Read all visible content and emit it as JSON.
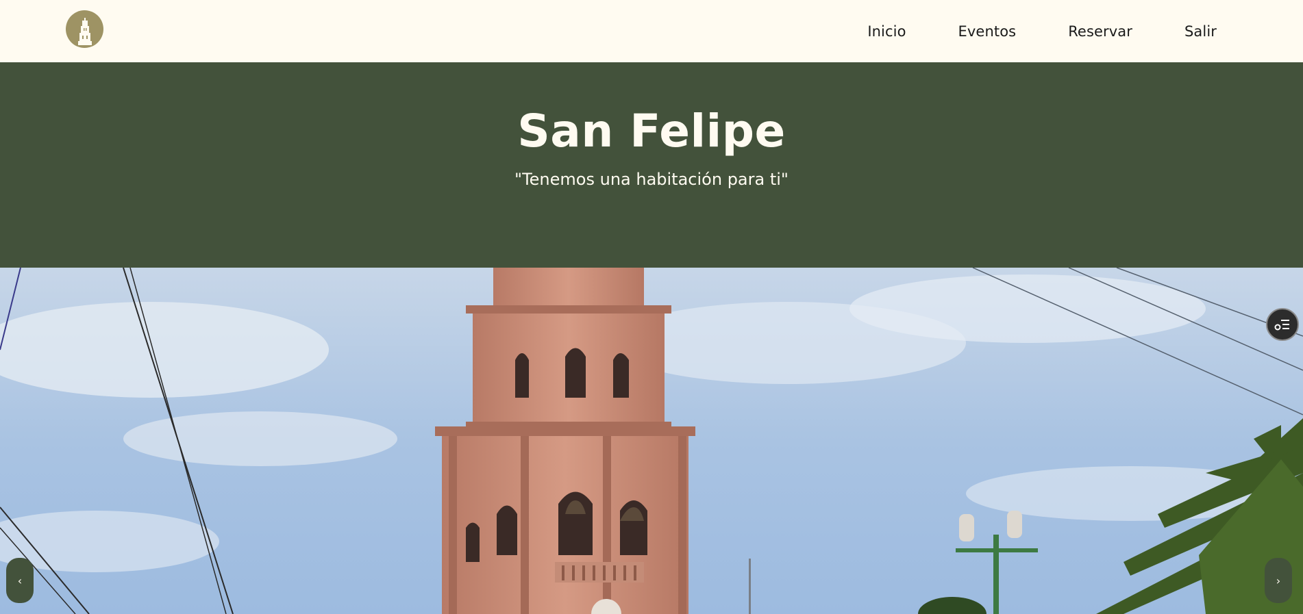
{
  "nav": {
    "logo_alt": "San Felipe logo",
    "links": [
      "Inicio",
      "Eventos",
      "Reservar",
      "Salir"
    ]
  },
  "hero": {
    "title": "San Felipe",
    "subtitle": "\"Tenemos una habitación para ti\""
  },
  "carousel": {
    "prev_label": "‹",
    "next_label": "›",
    "image_icon": "church-tower-photo"
  },
  "floating_button": {
    "icon": "accessibility-menu-icon"
  },
  "colors": {
    "background": "#fffbf1",
    "hero": "#43523b",
    "logo": "#9e9364"
  }
}
